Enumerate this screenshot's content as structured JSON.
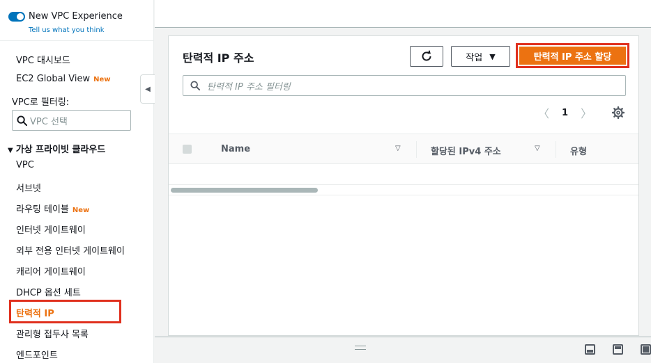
{
  "sidebar": {
    "toggle_label": "New VPC Experience",
    "feedback_link": "Tell us what you think",
    "items_top": [
      {
        "label": "VPC 대시보드",
        "badge": ""
      },
      {
        "label": "EC2 Global View",
        "badge": "New"
      }
    ],
    "filter_label": "VPC로 필터링:",
    "vpc_select_placeholder": "VPC 선택",
    "section_title": "가상 프라이빗 클라우드",
    "items": [
      {
        "label": "VPC",
        "badge": ""
      },
      {
        "label": "서브넷",
        "badge": ""
      },
      {
        "label": "라우팅 테이블",
        "badge": "New"
      },
      {
        "label": "인터넷 게이트웨이",
        "badge": ""
      },
      {
        "label": "외부 전용 인터넷 게이트웨이",
        "badge": ""
      },
      {
        "label": "캐리어 게이트웨이",
        "badge": ""
      },
      {
        "label": "DHCP 옵션 세트",
        "badge": ""
      },
      {
        "label": "탄력적 IP",
        "badge": ""
      },
      {
        "label": "관리형 접두사 목록",
        "badge": ""
      },
      {
        "label": "엔드포인트",
        "badge": ""
      }
    ]
  },
  "main": {
    "title": "탄력적 IP 주소",
    "action_label": "작업",
    "allocate_label": "탄력적 IP 주소 할당",
    "search_placeholder": "탄력적 IP 주소 필터링",
    "page_number": "1",
    "columns": [
      "Name",
      "할당된 IPv4 주소",
      "유형"
    ]
  },
  "colors": {
    "accent": "#ec7211",
    "highlight_border": "#e0301e",
    "link": "#0073bb"
  }
}
